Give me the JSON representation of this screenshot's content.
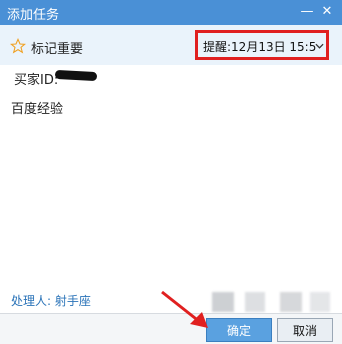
{
  "window": {
    "title": "添加任务",
    "minimize": "—",
    "close": "✕"
  },
  "toolbar": {
    "mark_label": "标记重要",
    "reminder_text": "提醒:12月13日 15:5"
  },
  "content": {
    "buyer_label": "买家ID:",
    "body": "百度经验"
  },
  "footer": {
    "handler_label": "处理人: ",
    "handler_name": "射手座",
    "ok_label": "确定",
    "cancel_label": "取消"
  }
}
